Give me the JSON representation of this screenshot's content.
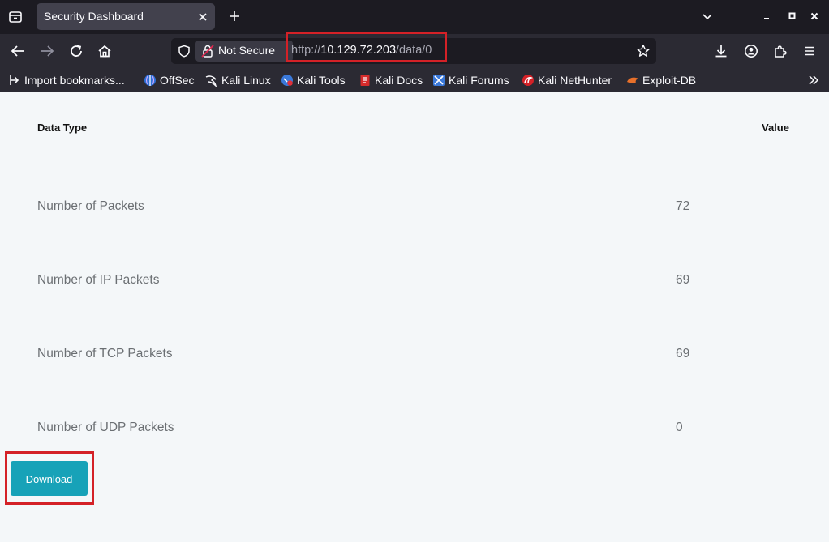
{
  "tab": {
    "title": "Security Dashboard"
  },
  "urlbar": {
    "security_label": "Not Secure",
    "url_scheme": "http://",
    "url_host": "10.129.72.203",
    "url_path": "/data/0"
  },
  "bookmarks": [
    {
      "label": "Import bookmarks...",
      "icon": "import-icon"
    },
    {
      "label": "OffSec",
      "icon": "offsec-icon"
    },
    {
      "label": "Kali Linux",
      "icon": "kali-dragon-icon"
    },
    {
      "label": "Kali Tools",
      "icon": "kali-tools-icon"
    },
    {
      "label": "Kali Docs",
      "icon": "kali-docs-icon"
    },
    {
      "label": "Kali Forums",
      "icon": "kali-forums-icon"
    },
    {
      "label": "Kali NetHunter",
      "icon": "nethunter-icon"
    },
    {
      "label": "Exploit-DB",
      "icon": "exploitdb-icon"
    }
  ],
  "table": {
    "headers": {
      "type": "Data Type",
      "value": "Value"
    },
    "rows": [
      {
        "label": "Number of Packets",
        "value": "72"
      },
      {
        "label": "Number of IP Packets",
        "value": "69"
      },
      {
        "label": "Number of TCP Packets",
        "value": "69"
      },
      {
        "label": "Number of UDP Packets",
        "value": "0"
      }
    ]
  },
  "download": {
    "label": "Download"
  },
  "colors": {
    "download_button": "#17a2b8",
    "highlight_box": "#d42127",
    "page_background": "#f4f7f9"
  }
}
